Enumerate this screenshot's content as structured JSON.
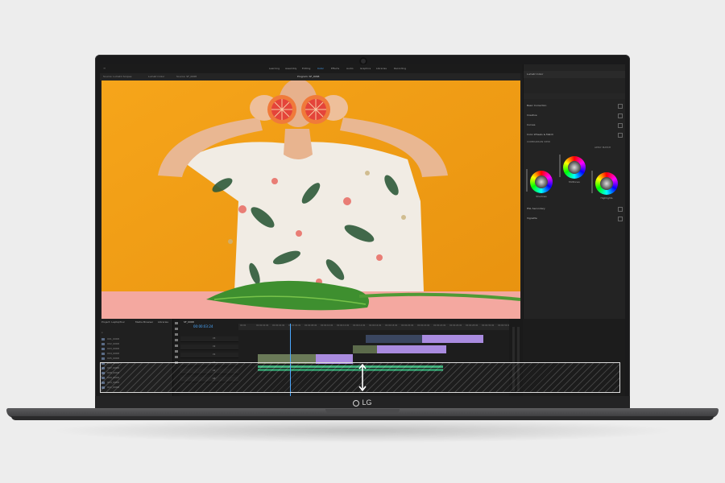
{
  "brand": {
    "logo_text": "LG"
  },
  "app": {
    "workspaces": [
      "Learning",
      "Assembly",
      "Editing",
      "Color",
      "Effects",
      "Audio",
      "Graphics",
      "Libraries",
      "Recording"
    ],
    "active_workspace": "Color",
    "program_tab": "Program: SF_0068",
    "source_tabs": [
      "Source: Lumetri Scopes",
      "Lumetri Color",
      "Source: SF_0068"
    ]
  },
  "lumetri": {
    "header": "Lumetri Color",
    "sections": [
      "Basic Correction",
      "Creative",
      "Curves",
      "Color Wheels & Match",
      "HSL Secondary",
      "Vignette"
    ],
    "wheel_labels": [
      "Shadows",
      "Midtones",
      "Highlights"
    ],
    "match_buttons": [
      "COMPARISON VIEW",
      "APPLY MATCH"
    ]
  },
  "project": {
    "tabs": [
      "Project: LaptopTour",
      "Media Browser",
      "Libraries"
    ],
    "items": [
      "001_0068",
      "002_0068",
      "003_0068",
      "004_0068",
      "005_0068",
      "006_0068",
      "007_0068",
      "008_0068",
      "009_0068",
      "010_0068",
      "011_0068"
    ]
  },
  "timeline": {
    "sequence_name": "SF_0068",
    "timecode": "00:00:03:24",
    "ruler_ticks": [
      "00:00",
      "00:00:02:00",
      "00:00:04:00",
      "00:00:06:00",
      "00:00:08:00",
      "00:00:10:00",
      "00:00:12:00",
      "00:00:14:00",
      "00:00:16:00",
      "00:00:18:00",
      "00:00:20:00",
      "00:00:22:00",
      "00:00:24:00",
      "00:00:26:00",
      "00:00:28:00",
      "00:00:30:00",
      "00:00:32:00"
    ],
    "tracks": [
      "V3",
      "V2",
      "V1",
      "A1",
      "A2",
      "A3"
    ]
  },
  "colors": {
    "accent": "#4aa8ff",
    "clip_purple": "#a98bdf",
    "clip_green": "#3fae7a",
    "backdrop_orange": "#f3a61b"
  }
}
